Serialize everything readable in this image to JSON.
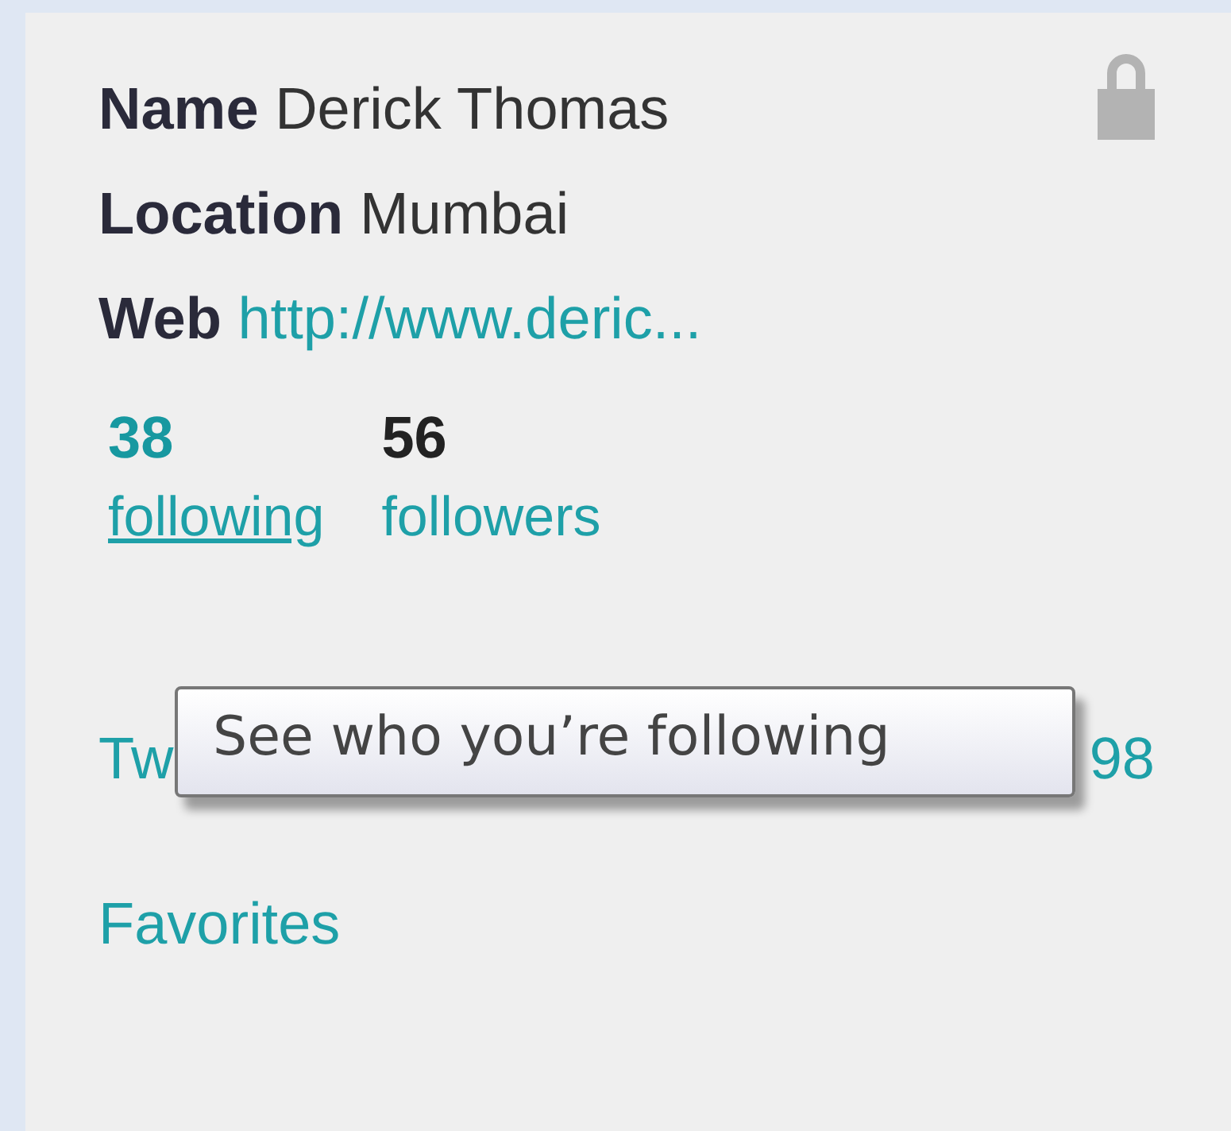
{
  "profile": {
    "locked": true,
    "fields": [
      {
        "label": "Name",
        "value": "Derick Thomas",
        "kind": "text"
      },
      {
        "label": "Location",
        "value": "Mumbai",
        "kind": "text"
      },
      {
        "label": "Web",
        "value": "http://www.deric...",
        "kind": "link"
      }
    ]
  },
  "stats": [
    {
      "count": "38",
      "label": "following",
      "hovered": true
    },
    {
      "count": "56",
      "label": "followers",
      "hovered": false
    }
  ],
  "tooltip": {
    "text": "See who you’re following"
  },
  "links": [
    {
      "label": "Tw",
      "count": "98"
    },
    {
      "label": "Favorites"
    }
  ]
}
